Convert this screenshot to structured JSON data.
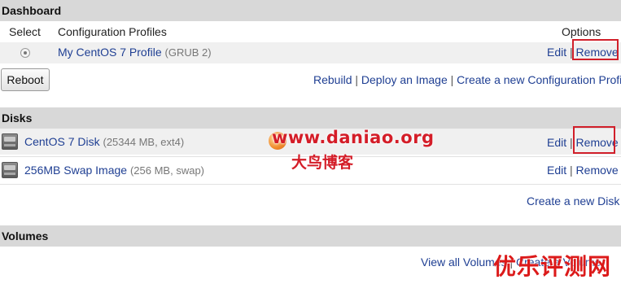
{
  "dashboard": {
    "title": "Dashboard",
    "columns": {
      "select": "Select",
      "profiles": "Configuration Profiles",
      "options": "Options"
    },
    "profile": {
      "name": "My CentOS 7 Profile",
      "meta": "(GRUB 2)",
      "edit": "Edit",
      "remove": "Remove"
    },
    "reboot_button": "Reboot",
    "actions": {
      "rebuild": "Rebuild",
      "deploy": "Deploy an Image",
      "create_profile": "Create a new Configuration Profile"
    },
    "separator": "|"
  },
  "disks": {
    "title": "Disks",
    "items": [
      {
        "name": "CentOS 7 Disk",
        "meta": "(25344 MB, ext4)",
        "edit": "Edit",
        "remove": "Remove"
      },
      {
        "name": "256MB Swap Image",
        "meta": "(256 MB, swap)",
        "edit": "Edit",
        "remove": "Remove"
      }
    ],
    "create_disk": "Create a new Disk"
  },
  "volumes": {
    "title": "Volumes",
    "view_all": "View all Volumes",
    "create_volume_partial": "Create a Volume"
  },
  "watermarks": {
    "url": "www.daniao.org",
    "cn_blog": "大鸟博客",
    "corner": "优乐评测网"
  },
  "colors": {
    "link": "#1f3f93",
    "header_bg": "#d8d8d8",
    "highlight_box": "#d11f2a"
  }
}
